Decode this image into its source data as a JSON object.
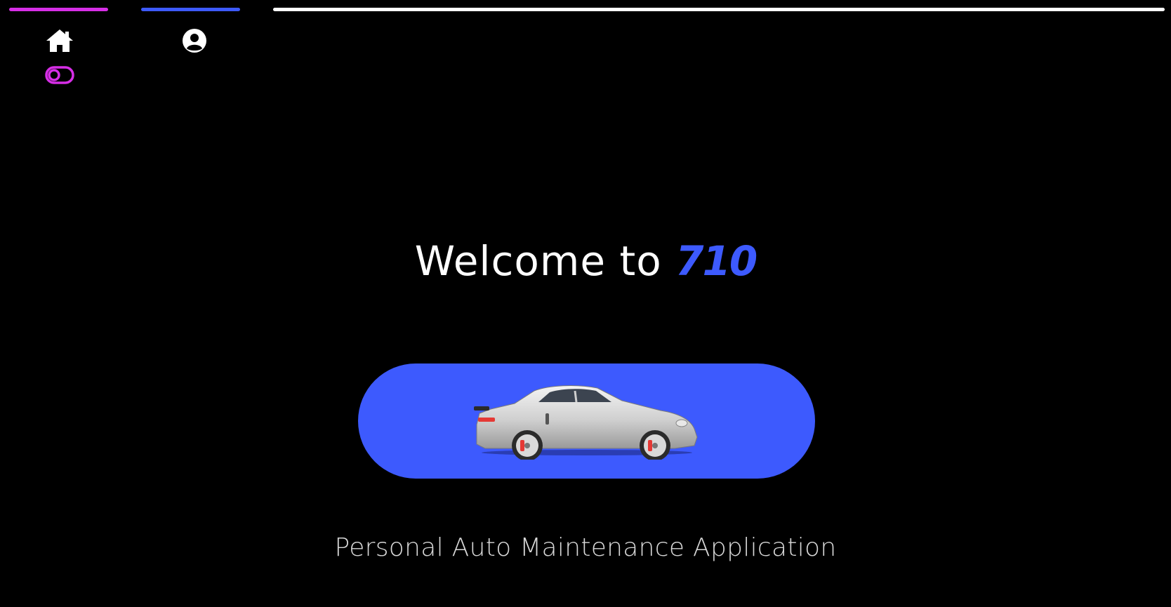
{
  "nav": {
    "items": [
      {
        "id": "home",
        "icon": "home-icon"
      },
      {
        "id": "profile",
        "icon": "user-circle-icon"
      }
    ],
    "theme_toggle": {
      "icon": "toggle-icon"
    }
  },
  "hero": {
    "welcome_prefix": "Welcome to ",
    "brand": "710",
    "car_image": "sports-car-illustration",
    "tagline": "Personal Auto Maintenance Application"
  },
  "colors": {
    "background": "#000000",
    "accent_magenta": "#d62ee6",
    "accent_blue": "#3d5afe",
    "bar_white": "#ffffff",
    "text": "#ffffff",
    "tagline": "#d8d8d8"
  }
}
